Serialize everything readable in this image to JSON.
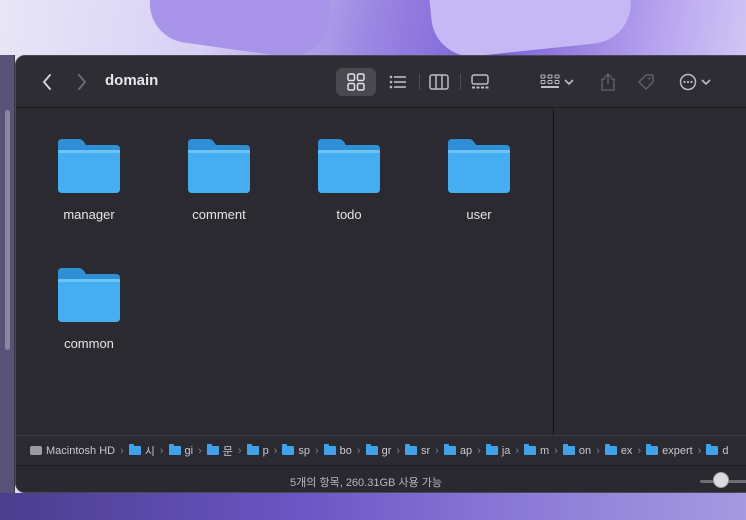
{
  "window": {
    "title": "domain"
  },
  "toolbar": {
    "back_icon": "chevron-left-icon",
    "forward_icon": "chevron-right-icon",
    "view_modes": [
      "icon-view",
      "list-view",
      "column-view",
      "gallery-view"
    ],
    "active_view": "icon-view"
  },
  "folders": [
    {
      "name": "manager"
    },
    {
      "name": "comment"
    },
    {
      "name": "todo"
    },
    {
      "name": "user"
    },
    {
      "name": "common"
    }
  ],
  "pathbar": {
    "items": [
      {
        "label": "Macintosh HD",
        "icon": "hd-icon"
      },
      {
        "label": "시",
        "icon": "folder-icon"
      },
      {
        "label": "gi",
        "icon": "folder-icon"
      },
      {
        "label": "문",
        "icon": "folder-icon"
      },
      {
        "label": "p",
        "icon": "folder-icon"
      },
      {
        "label": "sp",
        "icon": "folder-icon"
      },
      {
        "label": "bo",
        "icon": "folder-icon"
      },
      {
        "label": "gr",
        "icon": "folder-icon"
      },
      {
        "label": "sr",
        "icon": "folder-icon"
      },
      {
        "label": "ap",
        "icon": "folder-icon"
      },
      {
        "label": "ja",
        "icon": "folder-icon"
      },
      {
        "label": "m",
        "icon": "folder-icon"
      },
      {
        "label": "on",
        "icon": "folder-icon"
      },
      {
        "label": "ex",
        "icon": "folder-icon"
      },
      {
        "label": "expert",
        "icon": "folder-icon"
      },
      {
        "label": "d",
        "icon": "folder-icon"
      }
    ]
  },
  "status": {
    "text": "5개의 항목, 260.31GB 사용 가능"
  },
  "colors": {
    "folder": "#3fa3ec",
    "window_bg": "#2b2a31"
  }
}
